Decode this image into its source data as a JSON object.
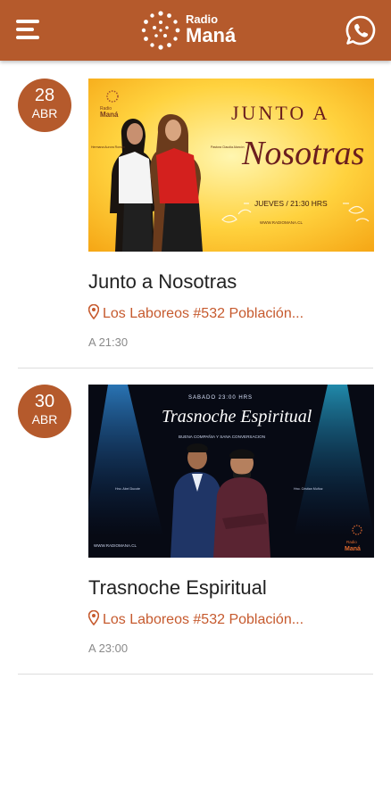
{
  "header": {
    "logo_radio": "Radio",
    "logo_mana": "Maná"
  },
  "colors": {
    "brand": "#b55a2c",
    "location": "#c65a2e",
    "muted": "#8a8a8a"
  },
  "events": [
    {
      "day": "28",
      "month": "ABR",
      "title": "Junto a Nosotras",
      "location": "Los Laboreos #532 Población...",
      "time": "A 21:30",
      "poster": {
        "headline_top": "JUNTO A",
        "headline_script": "Nosotras",
        "schedule": "JUEVES / 21:30 HRS",
        "website": "WWW.RADIOMANA.CL",
        "host_left": "Hermana Aurora Román",
        "host_right": "Pastora Claudia Alarcón",
        "brand_radio": "Radio",
        "brand_mana": "Maná"
      }
    },
    {
      "day": "30",
      "month": "ABR",
      "title": "Trasnoche Espiritual",
      "location": "Los Laboreos #532 Población...",
      "time": "A 23:00",
      "poster": {
        "schedule": "SABADO 23:00 HRS",
        "headline_script": "Trasnoche Espiritual",
        "tagline": "BUENA COMPAÑIA Y SANA CONVERSACION",
        "host_left": "Hno. Abel Ducote",
        "host_right": "Hno. Cristian Muñoz",
        "website": "WWW.RADIOMANA.CL",
        "brand_radio": "Radio",
        "brand_mana": "Maná"
      }
    }
  ]
}
